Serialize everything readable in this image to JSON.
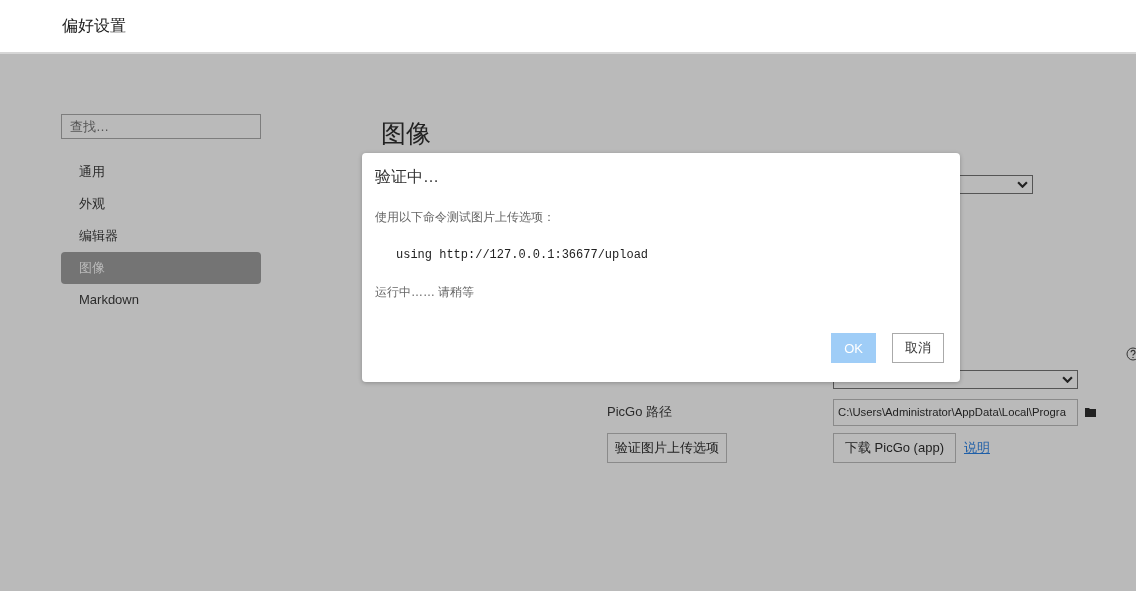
{
  "header": {
    "title": "偏好设置"
  },
  "sidebar": {
    "search": {
      "placeholder": "查找…"
    },
    "items": [
      {
        "label": "通用",
        "selected": false
      },
      {
        "label": "外观",
        "selected": false
      },
      {
        "label": "编辑器",
        "selected": false
      },
      {
        "label": "图像",
        "selected": true
      },
      {
        "label": "Markdown",
        "selected": false
      }
    ]
  },
  "content": {
    "title": "图像",
    "picgo_path": {
      "label": "PicGo 路径",
      "value": "C:\\Users\\Administrator\\AppData\\Local\\Progra"
    },
    "validate_button": "验证图片上传选项",
    "download_button": "下载 PicGo (app)",
    "help_link": "说明"
  },
  "dialog": {
    "title": "验证中…",
    "message": "使用以下命令测试图片上传选项：",
    "command": "using http://127.0.0.1:36677/upload",
    "status": "运行中…… 请稍等",
    "buttons": [
      {
        "label": "OK",
        "kind": "primary",
        "disabled": true
      },
      {
        "label": "取消",
        "kind": "secondary",
        "disabled": false
      }
    ]
  }
}
